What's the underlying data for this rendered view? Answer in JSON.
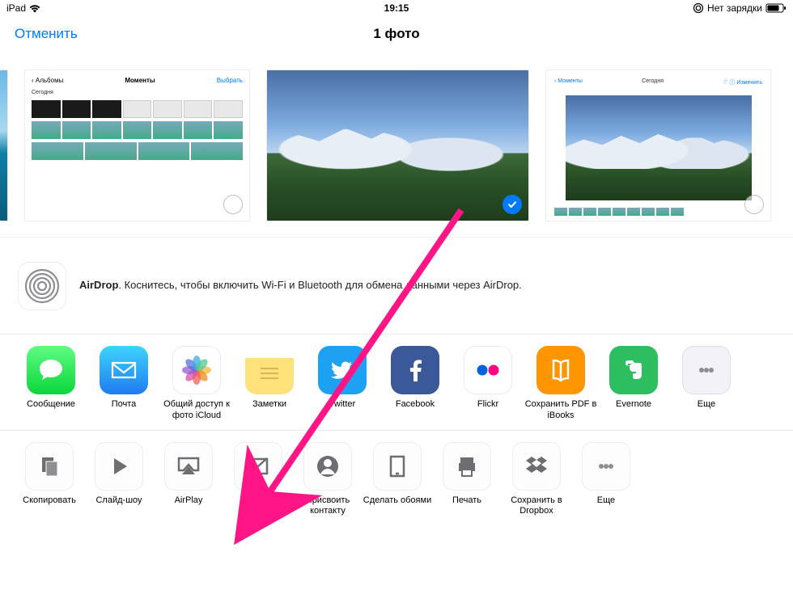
{
  "status": {
    "device": "iPad",
    "time": "19:15",
    "charge": "Нет зарядки"
  },
  "nav": {
    "cancel": "Отменить",
    "title": "1 фото"
  },
  "airdrop": {
    "bold": "AirDrop",
    "text": ". Коснитесь, чтобы включить Wi-Fi и Bluetooth для обмена данными через AirDrop."
  },
  "share": [
    {
      "label": "Сообщение",
      "icon": "message",
      "bg": "linear-gradient(#5efc82,#0bd63b)"
    },
    {
      "label": "Почта",
      "icon": "mail",
      "bg": "linear-gradient(#3ed4fd,#1f7cf0)"
    },
    {
      "label": "Общий доступ к фото iCloud",
      "icon": "photos",
      "bg": "#fff"
    },
    {
      "label": "Заметки",
      "icon": "notes",
      "bg": "linear-gradient(#fff 0% 25%, #fde27a 25% 100%)"
    },
    {
      "label": "Twitter",
      "icon": "twitter",
      "bg": "#1da1f2"
    },
    {
      "label": "Facebook",
      "icon": "facebook",
      "bg": "#3b5998"
    },
    {
      "label": "Flickr",
      "icon": "flickr",
      "bg": "#fff"
    },
    {
      "label": "Сохранить PDF в iBooks",
      "icon": "ibooks",
      "bg": "#ff9500"
    },
    {
      "label": "Evernote",
      "icon": "evernote",
      "bg": "#2dbe60"
    },
    {
      "label": "Еще",
      "icon": "more",
      "bg": "#f2f2f7"
    }
  ],
  "actions": [
    {
      "label": "Скопировать",
      "icon": "copy"
    },
    {
      "label": "Слайд-шоу",
      "icon": "play"
    },
    {
      "label": "AirPlay",
      "icon": "airplay"
    },
    {
      "label": "Скрыть",
      "icon": "hide"
    },
    {
      "label": "Присвоить контакту",
      "icon": "contact"
    },
    {
      "label": "Сделать обоями",
      "icon": "wallpaper"
    },
    {
      "label": "Печать",
      "icon": "print"
    },
    {
      "label": "Сохранить в Dropbox",
      "icon": "dropbox"
    },
    {
      "label": "Еще",
      "icon": "more"
    }
  ]
}
